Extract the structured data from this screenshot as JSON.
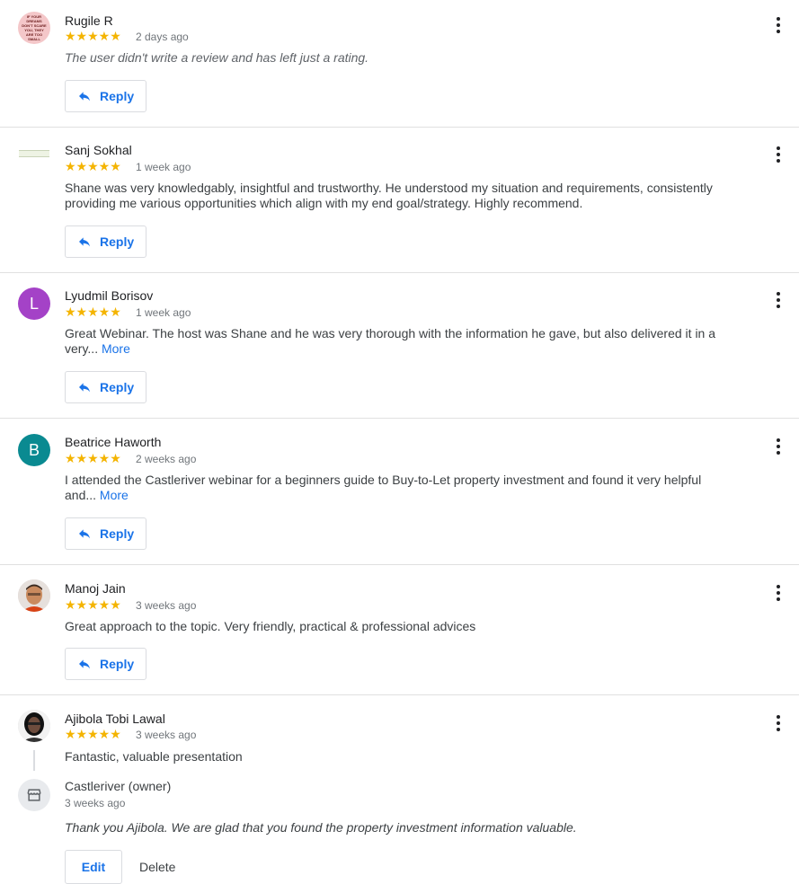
{
  "reviews": [
    {
      "name": "Rugile R",
      "stars": "★★★★★",
      "date": "2 days ago",
      "text": "The user didn't write a review and has left just a rating.",
      "avatar_text": "IF YOUR DREAMS DON'T SCARE YOU, THEY ARE TOO SMALL",
      "reply_label": "Reply"
    },
    {
      "name": "Sanj Sokhal",
      "stars": "★★★★★",
      "date": "1 week ago",
      "text": "Shane was very knowledgably, insightful and trustworthy. He understood my situation and requirements, consistently providing me various opportunities which align with my end goal/strategy. Highly recommend.",
      "reply_label": "Reply"
    },
    {
      "name": "Lyudmil Borisov",
      "stars": "★★★★★",
      "date": "1 week ago",
      "text": "Great Webinar. The host was Shane and he was very thorough with the information he gave, but also delivered it in a very...",
      "more": "More",
      "avatar_letter": "L",
      "reply_label": "Reply"
    },
    {
      "name": "Beatrice Haworth",
      "stars": "★★★★★",
      "date": "2 weeks ago",
      "text": "I attended the Castleriver webinar for a beginners guide to Buy-to-Let property investment and found it very helpful and...",
      "more": "More",
      "avatar_letter": "B",
      "reply_label": "Reply"
    },
    {
      "name": "Manoj Jain",
      "stars": "★★★★★",
      "date": "3 weeks ago",
      "text": "Great approach to the topic. Very friendly, practical & professional advices",
      "reply_label": "Reply"
    },
    {
      "name": "Ajibola Tobi Lawal",
      "stars": "★★★★★",
      "date": "3 weeks ago",
      "text": "Fantastic, valuable presentation"
    }
  ],
  "owner_reply": {
    "name": "Castleriver (owner)",
    "date": "3 weeks ago",
    "text": "Thank you Ajibola. We are glad that you found the property investment information valuable.",
    "edit_label": "Edit",
    "delete_label": "Delete"
  },
  "colors": {
    "star": "#f4b400",
    "link": "#1a73e8",
    "avatar_l": "#9c27b0",
    "avatar_b": "#00897b"
  }
}
